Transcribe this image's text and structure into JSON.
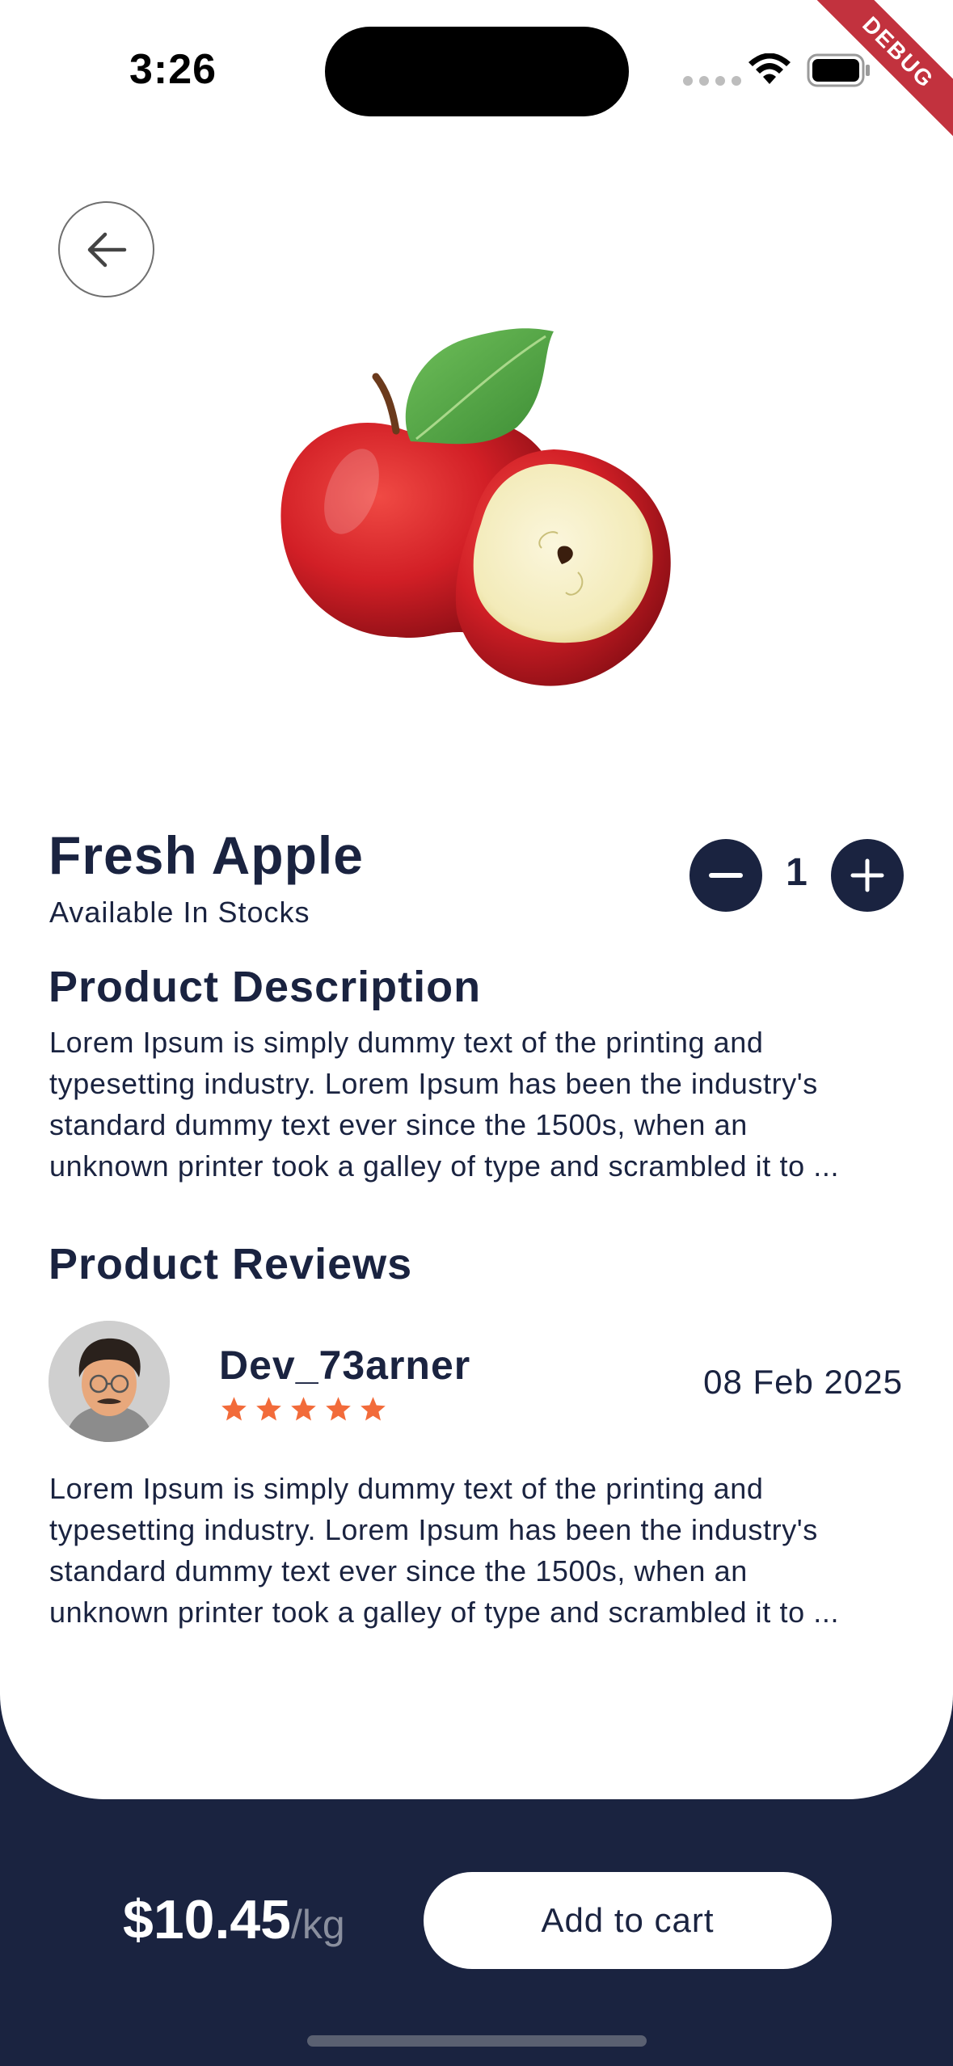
{
  "status_bar": {
    "time": "3:26",
    "debug_label": "DEBUG"
  },
  "product": {
    "name": "Fresh Apple",
    "availability": "Available In Stocks",
    "quantity": "1",
    "image_icon": "apple-image"
  },
  "description": {
    "title": "Product Description",
    "lines": [
      "Lorem Ipsum is simply dummy text of the printing and",
      "typesetting industry. Lorem Ipsum has been the industry's",
      "standard dummy text ever since the 1500s, when an",
      "unknown printer took a galley of type and scrambled it to ..."
    ]
  },
  "reviews": {
    "title": "Product Reviews",
    "items": [
      {
        "name": "Dev_73arner",
        "date": "08 Feb 2025",
        "rating": 5,
        "lines": [
          "Lorem Ipsum is simply dummy text of the printing and",
          "typesetting industry. Lorem Ipsum has been the industry's",
          "standard dummy text ever since the 1500s, when an",
          "unknown printer took a galley of type and scrambled it to ..."
        ]
      }
    ]
  },
  "footer": {
    "price": "$10.45",
    "unit": "/kg",
    "cart_label": "Add to cart"
  },
  "colors": {
    "primary": "#1a2340",
    "star": "#f26b3a",
    "background": "#ffffff"
  }
}
